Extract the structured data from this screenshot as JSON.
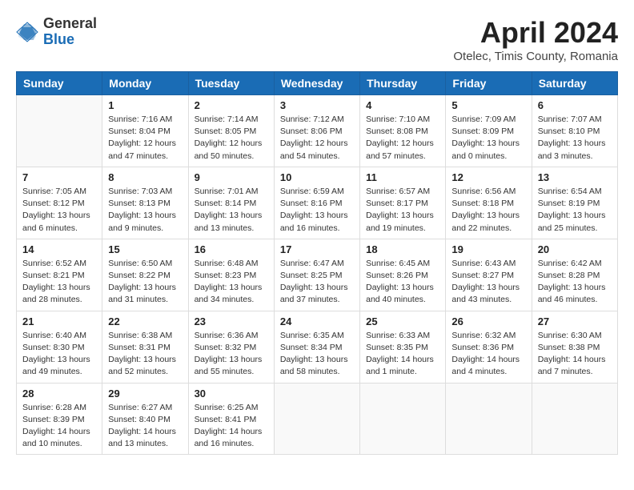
{
  "logo": {
    "general": "General",
    "blue": "Blue"
  },
  "title": "April 2024",
  "subtitle": "Otelec, Timis County, Romania",
  "days_header": [
    "Sunday",
    "Monday",
    "Tuesday",
    "Wednesday",
    "Thursday",
    "Friday",
    "Saturday"
  ],
  "weeks": [
    [
      {
        "num": "",
        "info": ""
      },
      {
        "num": "1",
        "info": "Sunrise: 7:16 AM\nSunset: 8:04 PM\nDaylight: 12 hours\nand 47 minutes."
      },
      {
        "num": "2",
        "info": "Sunrise: 7:14 AM\nSunset: 8:05 PM\nDaylight: 12 hours\nand 50 minutes."
      },
      {
        "num": "3",
        "info": "Sunrise: 7:12 AM\nSunset: 8:06 PM\nDaylight: 12 hours\nand 54 minutes."
      },
      {
        "num": "4",
        "info": "Sunrise: 7:10 AM\nSunset: 8:08 PM\nDaylight: 12 hours\nand 57 minutes."
      },
      {
        "num": "5",
        "info": "Sunrise: 7:09 AM\nSunset: 8:09 PM\nDaylight: 13 hours\nand 0 minutes."
      },
      {
        "num": "6",
        "info": "Sunrise: 7:07 AM\nSunset: 8:10 PM\nDaylight: 13 hours\nand 3 minutes."
      }
    ],
    [
      {
        "num": "7",
        "info": "Sunrise: 7:05 AM\nSunset: 8:12 PM\nDaylight: 13 hours\nand 6 minutes."
      },
      {
        "num": "8",
        "info": "Sunrise: 7:03 AM\nSunset: 8:13 PM\nDaylight: 13 hours\nand 9 minutes."
      },
      {
        "num": "9",
        "info": "Sunrise: 7:01 AM\nSunset: 8:14 PM\nDaylight: 13 hours\nand 13 minutes."
      },
      {
        "num": "10",
        "info": "Sunrise: 6:59 AM\nSunset: 8:16 PM\nDaylight: 13 hours\nand 16 minutes."
      },
      {
        "num": "11",
        "info": "Sunrise: 6:57 AM\nSunset: 8:17 PM\nDaylight: 13 hours\nand 19 minutes."
      },
      {
        "num": "12",
        "info": "Sunrise: 6:56 AM\nSunset: 8:18 PM\nDaylight: 13 hours\nand 22 minutes."
      },
      {
        "num": "13",
        "info": "Sunrise: 6:54 AM\nSunset: 8:19 PM\nDaylight: 13 hours\nand 25 minutes."
      }
    ],
    [
      {
        "num": "14",
        "info": "Sunrise: 6:52 AM\nSunset: 8:21 PM\nDaylight: 13 hours\nand 28 minutes."
      },
      {
        "num": "15",
        "info": "Sunrise: 6:50 AM\nSunset: 8:22 PM\nDaylight: 13 hours\nand 31 minutes."
      },
      {
        "num": "16",
        "info": "Sunrise: 6:48 AM\nSunset: 8:23 PM\nDaylight: 13 hours\nand 34 minutes."
      },
      {
        "num": "17",
        "info": "Sunrise: 6:47 AM\nSunset: 8:25 PM\nDaylight: 13 hours\nand 37 minutes."
      },
      {
        "num": "18",
        "info": "Sunrise: 6:45 AM\nSunset: 8:26 PM\nDaylight: 13 hours\nand 40 minutes."
      },
      {
        "num": "19",
        "info": "Sunrise: 6:43 AM\nSunset: 8:27 PM\nDaylight: 13 hours\nand 43 minutes."
      },
      {
        "num": "20",
        "info": "Sunrise: 6:42 AM\nSunset: 8:28 PM\nDaylight: 13 hours\nand 46 minutes."
      }
    ],
    [
      {
        "num": "21",
        "info": "Sunrise: 6:40 AM\nSunset: 8:30 PM\nDaylight: 13 hours\nand 49 minutes."
      },
      {
        "num": "22",
        "info": "Sunrise: 6:38 AM\nSunset: 8:31 PM\nDaylight: 13 hours\nand 52 minutes."
      },
      {
        "num": "23",
        "info": "Sunrise: 6:36 AM\nSunset: 8:32 PM\nDaylight: 13 hours\nand 55 minutes."
      },
      {
        "num": "24",
        "info": "Sunrise: 6:35 AM\nSunset: 8:34 PM\nDaylight: 13 hours\nand 58 minutes."
      },
      {
        "num": "25",
        "info": "Sunrise: 6:33 AM\nSunset: 8:35 PM\nDaylight: 14 hours\nand 1 minute."
      },
      {
        "num": "26",
        "info": "Sunrise: 6:32 AM\nSunset: 8:36 PM\nDaylight: 14 hours\nand 4 minutes."
      },
      {
        "num": "27",
        "info": "Sunrise: 6:30 AM\nSunset: 8:38 PM\nDaylight: 14 hours\nand 7 minutes."
      }
    ],
    [
      {
        "num": "28",
        "info": "Sunrise: 6:28 AM\nSunset: 8:39 PM\nDaylight: 14 hours\nand 10 minutes."
      },
      {
        "num": "29",
        "info": "Sunrise: 6:27 AM\nSunset: 8:40 PM\nDaylight: 14 hours\nand 13 minutes."
      },
      {
        "num": "30",
        "info": "Sunrise: 6:25 AM\nSunset: 8:41 PM\nDaylight: 14 hours\nand 16 minutes."
      },
      {
        "num": "",
        "info": ""
      },
      {
        "num": "",
        "info": ""
      },
      {
        "num": "",
        "info": ""
      },
      {
        "num": "",
        "info": ""
      }
    ]
  ]
}
